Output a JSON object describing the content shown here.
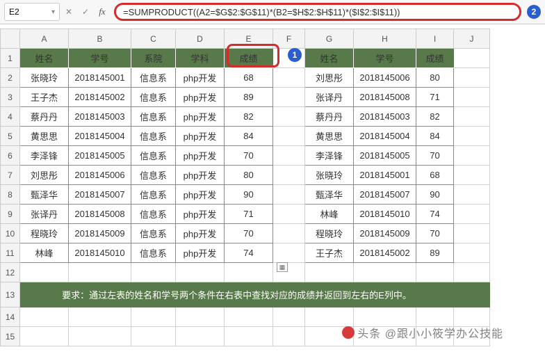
{
  "formula_bar": {
    "cell_ref": "E2",
    "cancel_glyph": "✕",
    "confirm_glyph": "✓",
    "fx_glyph": "fx",
    "formula": "=SUMPRODUCT((A2=$G$2:$G$11)*(B2=$H$2:$H$11)*($I$2:$I$11))"
  },
  "callouts": {
    "num1": "1",
    "num2": "2"
  },
  "columns": [
    "A",
    "B",
    "C",
    "D",
    "E",
    "F",
    "G",
    "H",
    "I",
    "J"
  ],
  "left_headers": {
    "A": "姓名",
    "B": "学号",
    "C": "系院",
    "D": "学科",
    "E": "成绩"
  },
  "right_headers": {
    "G": "姓名",
    "H": "学号",
    "I": "成绩"
  },
  "left_rows": [
    {
      "name": "张晓玲",
      "id": "2018145001",
      "dept": "信息系",
      "sub": "php开发",
      "score": "68"
    },
    {
      "name": "王子杰",
      "id": "2018145002",
      "dept": "信息系",
      "sub": "php开发",
      "score": "89"
    },
    {
      "name": "蔡丹丹",
      "id": "2018145003",
      "dept": "信息系",
      "sub": "php开发",
      "score": "82"
    },
    {
      "name": "黄思思",
      "id": "2018145004",
      "dept": "信息系",
      "sub": "php开发",
      "score": "84"
    },
    {
      "name": "李泽锋",
      "id": "2018145005",
      "dept": "信息系",
      "sub": "php开发",
      "score": "70"
    },
    {
      "name": "刘思彤",
      "id": "2018145006",
      "dept": "信息系",
      "sub": "php开发",
      "score": "80"
    },
    {
      "name": "甄泽华",
      "id": "2018145007",
      "dept": "信息系",
      "sub": "php开发",
      "score": "90"
    },
    {
      "name": "张译丹",
      "id": "2018145008",
      "dept": "信息系",
      "sub": "php开发",
      "score": "71"
    },
    {
      "name": "程晓玲",
      "id": "2018145009",
      "dept": "信息系",
      "sub": "php开发",
      "score": "70"
    },
    {
      "name": "林峰",
      "id": "2018145010",
      "dept": "信息系",
      "sub": "php开发",
      "score": "74"
    }
  ],
  "right_rows": [
    {
      "name": "刘思彤",
      "id": "2018145006",
      "score": "80"
    },
    {
      "name": "张译丹",
      "id": "2018145008",
      "score": "71"
    },
    {
      "name": "蔡丹丹",
      "id": "2018145003",
      "score": "82"
    },
    {
      "name": "黄思思",
      "id": "2018145004",
      "score": "84"
    },
    {
      "name": "李泽锋",
      "id": "2018145005",
      "score": "70"
    },
    {
      "name": "张晓玲",
      "id": "2018145001",
      "score": "68"
    },
    {
      "name": "甄泽华",
      "id": "2018145007",
      "score": "90"
    },
    {
      "name": "林峰",
      "id": "2018145010",
      "score": "74"
    },
    {
      "name": "程晓玲",
      "id": "2018145009",
      "score": "70"
    },
    {
      "name": "王子杰",
      "id": "2018145002",
      "score": "89"
    }
  ],
  "note": "要求：通过左表的姓名和学号两个条件在右表中查找对应的成绩并返回到左右的E列中。",
  "watermark": "头条 @跟小小筱学办公技能",
  "row_numbers": [
    "1",
    "2",
    "3",
    "4",
    "5",
    "6",
    "7",
    "8",
    "9",
    "10",
    "11",
    "12",
    "13",
    "14",
    "15"
  ]
}
